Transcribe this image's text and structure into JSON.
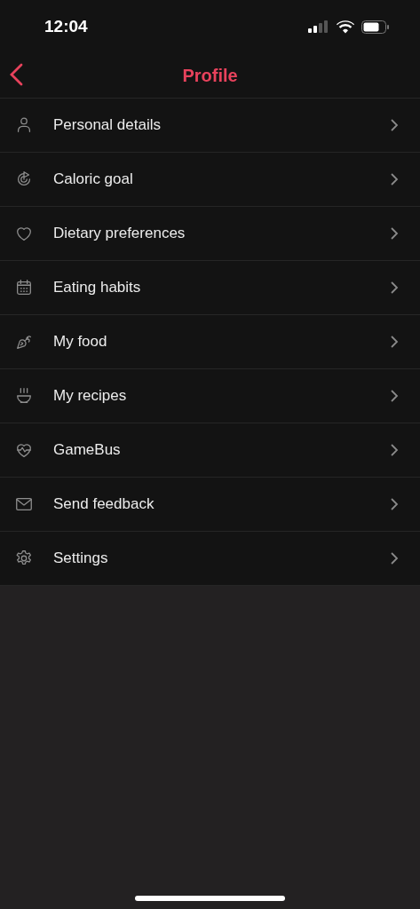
{
  "status_bar": {
    "time": "12:04"
  },
  "nav": {
    "title": "Profile"
  },
  "items": [
    {
      "label": "Personal details",
      "kind": "person"
    },
    {
      "label": "Caloric goal",
      "kind": "target"
    },
    {
      "label": "Dietary preferences",
      "kind": "heart"
    },
    {
      "label": "Eating habits",
      "kind": "calendar"
    },
    {
      "label": "My food",
      "kind": "carrot"
    },
    {
      "label": "My recipes",
      "kind": "bowl"
    },
    {
      "label": "GameBus",
      "kind": "pulse"
    },
    {
      "label": "Send feedback",
      "kind": "mail"
    },
    {
      "label": "Settings",
      "kind": "gear"
    }
  ]
}
